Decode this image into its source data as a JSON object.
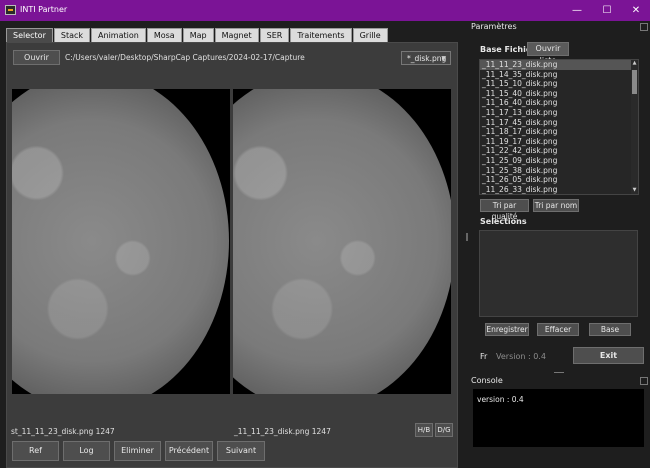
{
  "window": {
    "title": "INTI Partner",
    "minimize": "—",
    "maximize": "☐",
    "close": "✕"
  },
  "tabs": [
    "Selector",
    "Stack",
    "Animation",
    "Mosa",
    "Map",
    "Magnet",
    "SER",
    "Traitements",
    "Grille"
  ],
  "selector": {
    "open_label": "Ouvrir",
    "path": "C:/Users/valer/Desktop/SharpCap Captures/2024-02-17/Capture",
    "filter": "*_disk.png",
    "left_caption": "st_11_11_23_disk.png 1247",
    "right_caption": "_11_11_23_disk.png 1247",
    "hb_label": "H/B",
    "dg_label": "D/G",
    "buttons": {
      "ref": "Ref",
      "log": "Log",
      "eliminer": "Eliminer",
      "precedent": "Précédent",
      "suivant": "Suivant"
    }
  },
  "params": {
    "title": "Paramètres",
    "base_label": "Base Fichiers",
    "open_list": "Ouvrir liste",
    "files": [
      "_11_11_23_disk.png",
      "_11_14_35_disk.png",
      "_11_15_10_disk.png",
      "_11_15_40_disk.png",
      "_11_16_40_disk.png",
      "_11_17_13_disk.png",
      "_11_17_45_disk.png",
      "_11_18_17_disk.png",
      "_11_19_17_disk.png",
      "_11_22_42_disk.png",
      "_11_25_09_disk.png",
      "_11_25_38_disk.png",
      "_11_26_05_disk.png",
      "_11_26_33_disk.png"
    ],
    "sort_quality": "Tri par qualité",
    "sort_name": "Tri par nom",
    "selections_label": "Selections",
    "enregistrer": "Enregistrer",
    "effacer": "Effacer",
    "base": "Base",
    "lang": "Fr",
    "version": "Version : 0.4",
    "exit": "Exit"
  },
  "console": {
    "title": "Console",
    "text": "version :  0.4"
  }
}
